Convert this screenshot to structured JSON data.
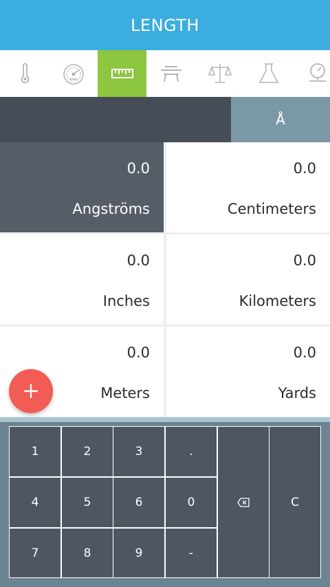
{
  "header": {
    "title": "LENGTH"
  },
  "tabs": [
    {
      "icon": "thermometer-icon",
      "active": false
    },
    {
      "icon": "speedometer-icon",
      "active": false
    },
    {
      "icon": "ruler-icon",
      "active": true
    },
    {
      "icon": "table-icon",
      "active": false
    },
    {
      "icon": "scale-icon",
      "active": false
    },
    {
      "icon": "flask-icon",
      "active": false
    },
    {
      "icon": "pressure-gauge-icon",
      "active": false
    }
  ],
  "input": {
    "value": "",
    "unit": "Å"
  },
  "units": [
    {
      "value": "0.0",
      "name": "Angströms",
      "selected": true
    },
    {
      "value": "0.0",
      "name": "Centimeters",
      "selected": false
    },
    {
      "value": "0.0",
      "name": "Inches",
      "selected": false
    },
    {
      "value": "0.0",
      "name": "Kilometers",
      "selected": false
    },
    {
      "value": "0.0",
      "name": "Meters",
      "selected": false
    },
    {
      "value": "0.0",
      "name": "Yards",
      "selected": false
    }
  ],
  "keypad": {
    "keys": [
      "1",
      "2",
      "3",
      ".",
      "4",
      "5",
      "6",
      "0",
      "7",
      "8",
      "9",
      "-"
    ],
    "backspace_icon": "backspace-icon",
    "clear_label": "C"
  },
  "colors": {
    "header": "#3badde",
    "active_tab": "#8dc63f",
    "input_bg": "#464d56",
    "unit_bg": "#7a98a5",
    "selected_cell": "#555e66",
    "fab": "#f25c54",
    "key": "#4e5761"
  }
}
